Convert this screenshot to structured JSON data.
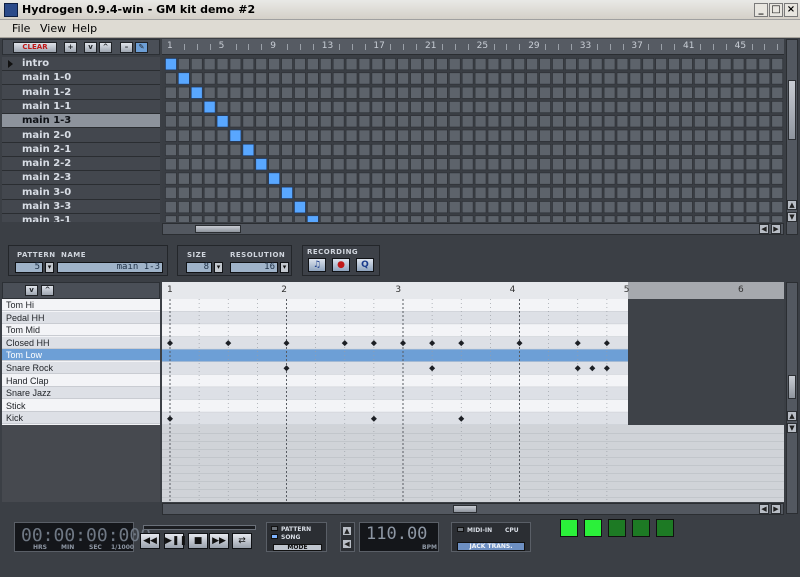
{
  "window": {
    "title": "Hydrogen 0.9.4-win - GM kit demo #2",
    "minimize": "_",
    "maximize": "□",
    "close": "×"
  },
  "menu": [
    "File",
    "View",
    "Help"
  ],
  "song_editor": {
    "toolbar": {
      "clear": "CLEAR",
      "add": "+",
      "down": "v",
      "up": "^",
      "icon1": "–",
      "icon2": "✎"
    },
    "ruler": [
      "1",
      "5",
      "9",
      "13",
      "17",
      "21",
      "25",
      "29",
      "33",
      "37",
      "41",
      "45",
      "49"
    ],
    "patterns": [
      "intro",
      "main 1-0",
      "main 1-2",
      "main 1-1",
      "main 1-3",
      "main 2-0",
      "main 2-1",
      "main 2-2",
      "main 2-3",
      "main 3-0",
      "main 3-3",
      "main 3-1"
    ],
    "selected_pattern": "main 1-3",
    "active_cells": [
      {
        "pattern": 0,
        "bar": 1
      },
      {
        "pattern": 1,
        "bar": 2
      },
      {
        "pattern": 2,
        "bar": 3
      },
      {
        "pattern": 3,
        "bar": 4
      },
      {
        "pattern": 4,
        "bar": 5
      },
      {
        "pattern": 5,
        "bar": 6
      },
      {
        "pattern": 6,
        "bar": 7
      },
      {
        "pattern": 7,
        "bar": 8
      },
      {
        "pattern": 8,
        "bar": 9
      },
      {
        "pattern": 9,
        "bar": 10
      },
      {
        "pattern": 10,
        "bar": 11
      },
      {
        "pattern": 11,
        "bar": 12
      }
    ],
    "scroll_arrows": {
      "left": "◀",
      "right": "▶",
      "up": "▲",
      "down": "▼"
    }
  },
  "pattern_panel": {
    "pattern_label": "PATTERN",
    "name_label": "NAME",
    "pattern_number": "5",
    "pattern_name": "main 1-3",
    "size_label": "SIZE",
    "size_value": "8",
    "resolution_label": "RESOLUTION",
    "resolution_value": "16",
    "recording_label": "RECORDING",
    "rec_buttons": [
      "♫",
      "●",
      "Q"
    ],
    "dropdown": "▾"
  },
  "pattern_editor": {
    "ruler": [
      "1",
      "2",
      "3",
      "4",
      "5",
      "6"
    ],
    "instruments": [
      "Tom Hi",
      "Pedal HH",
      "Tom Mid",
      "Closed HH",
      "Tom Low",
      "Snare Rock",
      "Hand Clap",
      "Snare Jazz",
      "Stick",
      "Kick"
    ],
    "selected_instrument": "Tom Low",
    "notes": [
      {
        "instrument": 3,
        "steps": [
          0,
          2,
          4,
          6,
          7,
          8,
          9,
          10,
          12,
          14,
          15
        ]
      },
      {
        "instrument": 5,
        "steps": [
          4,
          9,
          14,
          14.5,
          15
        ]
      },
      {
        "instrument": 9,
        "steps": [
          0,
          7,
          10
        ]
      }
    ]
  },
  "transport": {
    "time": "00:00:00:000",
    "time_units": [
      "HRS",
      "MIN",
      "SEC",
      "1/1000"
    ],
    "buttons": [
      "◀◀",
      "▶❚❚",
      "■",
      "▶▶",
      "⇄"
    ],
    "mode_pattern": "PATTERN",
    "mode_song": "SONG",
    "mode_button": "MODE",
    "bpm": "110.00",
    "bpm_label": "BPM",
    "midi_in": "MIDI-IN",
    "cpu": "CPU",
    "jack_trans": "JACK TRANS.",
    "meter_leds": [
      {
        "color": "#2bf03a",
        "on": true
      },
      {
        "color": "#2bf03a",
        "on": true
      },
      {
        "color": "#1d7a24",
        "on": false
      },
      {
        "color": "#1d7a24",
        "on": false
      },
      {
        "color": "#1d7a24",
        "on": false
      }
    ]
  }
}
